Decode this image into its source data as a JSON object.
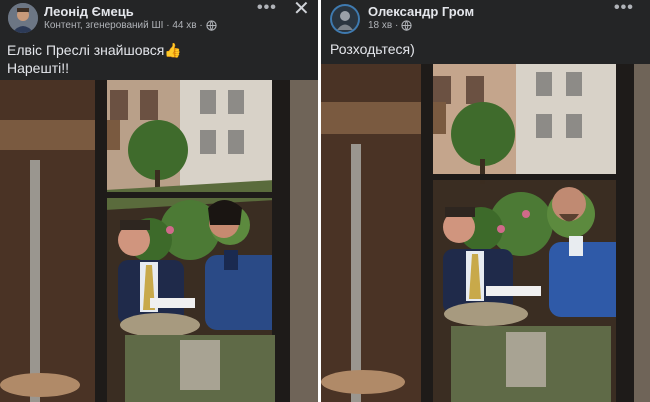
{
  "posts": [
    {
      "author": "Леонід Ємець",
      "meta_line": "Контент, згенерований ШІ · 44 хв ·",
      "text_line1": "Елвіс Преслі знайшовся👍",
      "text_line2": "Нарешті!!",
      "more_icon": "more-horizontal-icon",
      "close_icon": "close-icon",
      "privacy_icon": "globe-icon"
    },
    {
      "author": "Олександр Гром",
      "meta_line": "18 хв ·",
      "text_line1": "Розходьтеся)",
      "more_icon": "more-horizontal-icon",
      "close_icon": "close-icon",
      "privacy_icon": "globe-icon"
    }
  ],
  "colors": {
    "post_background": "#242526",
    "primary_text": "#e4e6eb",
    "secondary_text": "#b0b3b8"
  }
}
